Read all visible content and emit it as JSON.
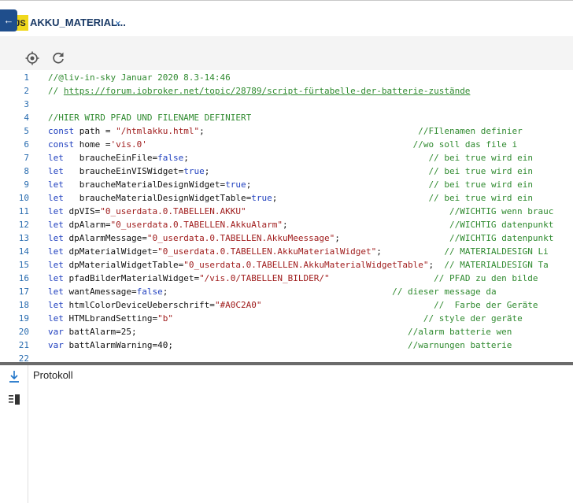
{
  "tab": {
    "badge": "JS",
    "title": "AKKU_MATERIAL...",
    "close": "×",
    "back": "←"
  },
  "toolbar": {
    "icons": [
      "crosshair-icon",
      "refresh-icon"
    ]
  },
  "colors": {
    "accent": "#1f5fa8",
    "comment": "#2f8a2f",
    "keyword": "#1f3fbf",
    "string": "#a01d1d",
    "line_number": "#2a6db0",
    "separator": "#6b6b6b"
  },
  "editor": {
    "lines": [
      {
        "n": "1",
        "segs": [
          {
            "t": "//@liv-in-sky Januar 2020 8.3-14:46",
            "c": "cm"
          }
        ]
      },
      {
        "n": "2",
        "segs": [
          {
            "t": "// ",
            "c": "cm"
          },
          {
            "t": "https://forum.iobroker.net/topic/28789/script-fürtabelle-der-batterie-zustände",
            "c": "link"
          }
        ]
      },
      {
        "n": "3",
        "segs": []
      },
      {
        "n": "4",
        "segs": [
          {
            "t": "//HIER WIRD PFAD UND FILENAME DEFINIERT",
            "c": "cm"
          }
        ]
      },
      {
        "n": "5",
        "segs": [
          {
            "t": "const",
            "c": "kw"
          },
          {
            "t": " path = ",
            "c": ""
          },
          {
            "t": "\"/htmlakku.html\"",
            "c": "str"
          },
          {
            "t": ";                                         ",
            "c": ""
          },
          {
            "t": "//FIlenamen definier",
            "c": "cm"
          }
        ]
      },
      {
        "n": "6",
        "segs": [
          {
            "t": "const",
            "c": "kw"
          },
          {
            "t": " home =",
            "c": ""
          },
          {
            "t": "'vis.0'",
            "c": "str"
          },
          {
            "t": "                                                   ",
            "c": ""
          },
          {
            "t": "//wo soll das file i",
            "c": "cm"
          }
        ]
      },
      {
        "n": "7",
        "segs": [
          {
            "t": "let",
            "c": "kw"
          },
          {
            "t": "   braucheEinFile=",
            "c": ""
          },
          {
            "t": "false",
            "c": "kw"
          },
          {
            "t": ";                                              ",
            "c": ""
          },
          {
            "t": "// bei true wird ein",
            "c": "cm"
          }
        ]
      },
      {
        "n": "8",
        "segs": [
          {
            "t": "let",
            "c": "kw"
          },
          {
            "t": "   braucheEinVISWidget=",
            "c": ""
          },
          {
            "t": "true",
            "c": "kw"
          },
          {
            "t": ";                                          ",
            "c": ""
          },
          {
            "t": "// bei true wird ein",
            "c": "cm"
          }
        ]
      },
      {
        "n": "9",
        "segs": [
          {
            "t": "let",
            "c": "kw"
          },
          {
            "t": "   braucheMaterialDesignWidget=",
            "c": ""
          },
          {
            "t": "true",
            "c": "kw"
          },
          {
            "t": ";                                  ",
            "c": ""
          },
          {
            "t": "// bei true wird ein",
            "c": "cm"
          }
        ]
      },
      {
        "n": "10",
        "segs": [
          {
            "t": "let",
            "c": "kw"
          },
          {
            "t": "   braucheMaterialDesignWidgetTable=",
            "c": ""
          },
          {
            "t": "true",
            "c": "kw"
          },
          {
            "t": ";                             ",
            "c": ""
          },
          {
            "t": "// bei true wird ein",
            "c": "cm"
          }
        ]
      },
      {
        "n": "11",
        "segs": [
          {
            "t": "let",
            "c": "kw"
          },
          {
            "t": " dpVIS=",
            "c": ""
          },
          {
            "t": "\"0_userdata.0.TABELLEN.AKKU\"",
            "c": "str"
          },
          {
            "t": "                                       ",
            "c": ""
          },
          {
            "t": "//WICHTIG wenn brauc",
            "c": "cm"
          }
        ]
      },
      {
        "n": "12",
        "segs": [
          {
            "t": "let",
            "c": "kw"
          },
          {
            "t": " dpAlarm=",
            "c": ""
          },
          {
            "t": "\"0_userdata.0.TABELLEN.AkkuAlarm\"",
            "c": "str"
          },
          {
            "t": ";                               ",
            "c": ""
          },
          {
            "t": "//WICHTIG datenpunkt",
            "c": "cm"
          }
        ]
      },
      {
        "n": "13",
        "segs": [
          {
            "t": "let",
            "c": "kw"
          },
          {
            "t": " dpAlarmMessage=",
            "c": ""
          },
          {
            "t": "\"0_userdata.0.TABELLEN.AkkuMeessage\"",
            "c": "str"
          },
          {
            "t": ";                     ",
            "c": ""
          },
          {
            "t": "//WICHTIG datenpunkt",
            "c": "cm"
          }
        ]
      },
      {
        "n": "14",
        "segs": [
          {
            "t": "let",
            "c": "kw"
          },
          {
            "t": " dpMaterialWidget=",
            "c": ""
          },
          {
            "t": "\"0_userdata.0.TABELLEN.AkkuMaterialWidget\"",
            "c": "str"
          },
          {
            "t": ";            ",
            "c": ""
          },
          {
            "t": "// MATERIALDESIGN Li",
            "c": "cm"
          }
        ]
      },
      {
        "n": "15",
        "segs": [
          {
            "t": "let",
            "c": "kw"
          },
          {
            "t": " dpMaterialWidgetTable=",
            "c": ""
          },
          {
            "t": "\"0_userdata.0.TABELLEN.AkkuMaterialWidgetTable\"",
            "c": "str"
          },
          {
            "t": ";  ",
            "c": ""
          },
          {
            "t": "// MATERIALDESIGN Ta",
            "c": "cm"
          }
        ]
      },
      {
        "n": "16",
        "segs": [
          {
            "t": "let",
            "c": "kw"
          },
          {
            "t": " pfadBilderMaterialWidget=",
            "c": ""
          },
          {
            "t": "\"/vis.0/TABELLEN_BILDER/\"",
            "c": "str"
          },
          {
            "t": "                    ",
            "c": ""
          },
          {
            "t": "// PFAD zu den bilde",
            "c": "cm"
          }
        ]
      },
      {
        "n": "17",
        "segs": [
          {
            "t": "let",
            "c": "kw"
          },
          {
            "t": " wantAmessage=",
            "c": ""
          },
          {
            "t": "false",
            "c": "kw"
          },
          {
            "t": ";                                           ",
            "c": ""
          },
          {
            "t": "// dieser message da",
            "c": "cm"
          }
        ]
      },
      {
        "n": "18",
        "segs": [
          {
            "t": "let",
            "c": "kw"
          },
          {
            "t": " htmlColorDeviceUeberschrift=",
            "c": ""
          },
          {
            "t": "\"#A0C2A0\"",
            "c": "str"
          },
          {
            "t": "                                 ",
            "c": ""
          },
          {
            "t": "//  Farbe der Geräte",
            "c": "cm"
          }
        ]
      },
      {
        "n": "19",
        "segs": [
          {
            "t": "let",
            "c": "kw"
          },
          {
            "t": " HTMLbrandSetting=",
            "c": ""
          },
          {
            "t": "\"b\"",
            "c": "str"
          },
          {
            "t": "                                                ",
            "c": ""
          },
          {
            "t": "// style der geräte",
            "c": "cm"
          }
        ]
      },
      {
        "n": "20",
        "segs": [
          {
            "t": "var",
            "c": "kw"
          },
          {
            "t": " battAlarm=25;                                                    ",
            "c": ""
          },
          {
            "t": "//alarm batterie wen",
            "c": "cm"
          }
        ]
      },
      {
        "n": "21",
        "segs": [
          {
            "t": "var",
            "c": "kw"
          },
          {
            "t": " battAlarmWarning=40;                                             ",
            "c": ""
          },
          {
            "t": "//warnungen batterie",
            "c": "cm"
          }
        ]
      },
      {
        "n": "22",
        "segs": []
      }
    ]
  },
  "protocol": {
    "title": "Protokoll",
    "icons": [
      "download-to-bottom-icon",
      "log-list-icon"
    ]
  }
}
